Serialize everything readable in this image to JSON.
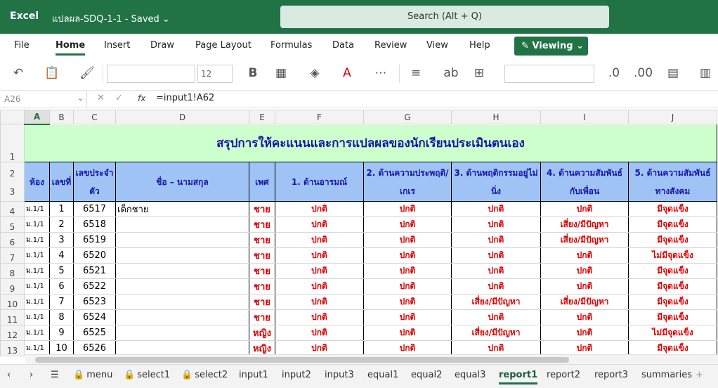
{
  "app": {
    "name": "Excel",
    "doc_title": "แปลผล-SDQ-1-1  -  Saved ⌄",
    "search_placeholder": "Search (Alt + Q)"
  },
  "menu": [
    "File",
    "Home",
    "Insert",
    "Draw",
    "Page Layout",
    "Formulas",
    "Data",
    "Review",
    "View",
    "Help"
  ],
  "viewing_label": "Viewing ⌄",
  "toolbar": {
    "font_size": "12"
  },
  "formula_bar": {
    "name_box": "A26",
    "fx": "fx",
    "formula": "=input1!A62"
  },
  "columns": [
    "A",
    "B",
    "C",
    "D",
    "E",
    "F",
    "G",
    "H",
    "I",
    "J"
  ],
  "sheet_title": "สรุปการให้คะแนนและการแปลผลของนักเรียนประเมินตนเอง",
  "headers": {
    "room": "ห้อง",
    "no": "เลขที่",
    "id": "เลขประจำตัว",
    "name": "ชื่อ – นามสกุล",
    "sex": "เพศ",
    "f": "1. ด้านอารมณ์",
    "g": "2. ด้านความประพฤติ/เกเร",
    "h": "3. ด้านพฤติกรรมอยู่ไม่นิ่ง",
    "i": "4. ด้านความสัมพันธ์กับเพื่อน",
    "j": "5. ด้านความสัมพันธ์ทางสังคม"
  },
  "rows": [
    {
      "r": "4",
      "room": "ม.1/1",
      "no": "1",
      "id": "6517",
      "name": "เด็กชาย",
      "sex": "ชาย",
      "f": "ปกติ",
      "g": "ปกติ",
      "h": "ปกติ",
      "i": "ปกติ",
      "j": "มีจุดแข็ง"
    },
    {
      "r": "5",
      "room": "ม.1/1",
      "no": "2",
      "id": "6518",
      "name": "",
      "sex": "ชาย",
      "f": "ปกติ",
      "g": "ปกติ",
      "h": "ปกติ",
      "i": "เสี่ยง/มีปัญหา",
      "j": "มีจุดแข็ง"
    },
    {
      "r": "6",
      "room": "ม.1/1",
      "no": "3",
      "id": "6519",
      "name": "",
      "sex": "ชาย",
      "f": "ปกติ",
      "g": "ปกติ",
      "h": "ปกติ",
      "i": "เสี่ยง/มีปัญหา",
      "j": "มีจุดแข็ง"
    },
    {
      "r": "7",
      "room": "ม.1/1",
      "no": "4",
      "id": "6520",
      "name": "",
      "sex": "ชาย",
      "f": "ปกติ",
      "g": "ปกติ",
      "h": "ปกติ",
      "i": "ปกติ",
      "j": "ไม่มีจุดแข็ง"
    },
    {
      "r": "8",
      "room": "ม.1/1",
      "no": "5",
      "id": "6521",
      "name": "",
      "sex": "ชาย",
      "f": "ปกติ",
      "g": "ปกติ",
      "h": "ปกติ",
      "i": "ปกติ",
      "j": "มีจุดแข็ง"
    },
    {
      "r": "9",
      "room": "ม.1/1",
      "no": "6",
      "id": "6522",
      "name": "",
      "sex": "ชาย",
      "f": "ปกติ",
      "g": "ปกติ",
      "h": "ปกติ",
      "i": "ปกติ",
      "j": "มีจุดแข็ง"
    },
    {
      "r": "10",
      "room": "ม.1/1",
      "no": "7",
      "id": "6523",
      "name": "",
      "sex": "ชาย",
      "f": "ปกติ",
      "g": "ปกติ",
      "h": "เสี่ยง/มีปัญหา",
      "i": "เสี่ยง/มีปัญหา",
      "j": "มีจุดแข็ง"
    },
    {
      "r": "11",
      "room": "ม.1/1",
      "no": "8",
      "id": "6524",
      "name": "",
      "sex": "ชาย",
      "f": "ปกติ",
      "g": "ปกติ",
      "h": "ปกติ",
      "i": "ปกติ",
      "j": "มีจุดแข็ง"
    },
    {
      "r": "12",
      "room": "ม.1/1",
      "no": "9",
      "id": "6525",
      "name": "",
      "sex": "หญิง",
      "f": "ปกติ",
      "g": "ปกติ",
      "h": "เสี่ยง/มีปัญหา",
      "i": "ปกติ",
      "j": "ไม่มีจุดแข็ง"
    },
    {
      "r": "13",
      "room": "ม.1/1",
      "no": "10",
      "id": "6526",
      "name": "",
      "sex": "หญิง",
      "f": "ปกติ",
      "g": "ปกติ",
      "h": "ปกติ",
      "i": "ปกติ",
      "j": "มีจุดแข็ง"
    }
  ],
  "tabs": [
    {
      "label": "menu",
      "locked": true
    },
    {
      "label": "select1",
      "locked": true
    },
    {
      "label": "select2",
      "locked": true
    },
    {
      "label": "input1",
      "locked": false
    },
    {
      "label": "input2",
      "locked": false
    },
    {
      "label": "input3",
      "locked": false
    },
    {
      "label": "equal1",
      "locked": false
    },
    {
      "label": "equal2",
      "locked": false
    },
    {
      "label": "equal3",
      "locked": false
    },
    {
      "label": "report1",
      "locked": false,
      "active": true
    },
    {
      "label": "report2",
      "locked": false
    },
    {
      "label": "report3",
      "locked": false
    },
    {
      "label": "summaries",
      "locked": false
    }
  ]
}
